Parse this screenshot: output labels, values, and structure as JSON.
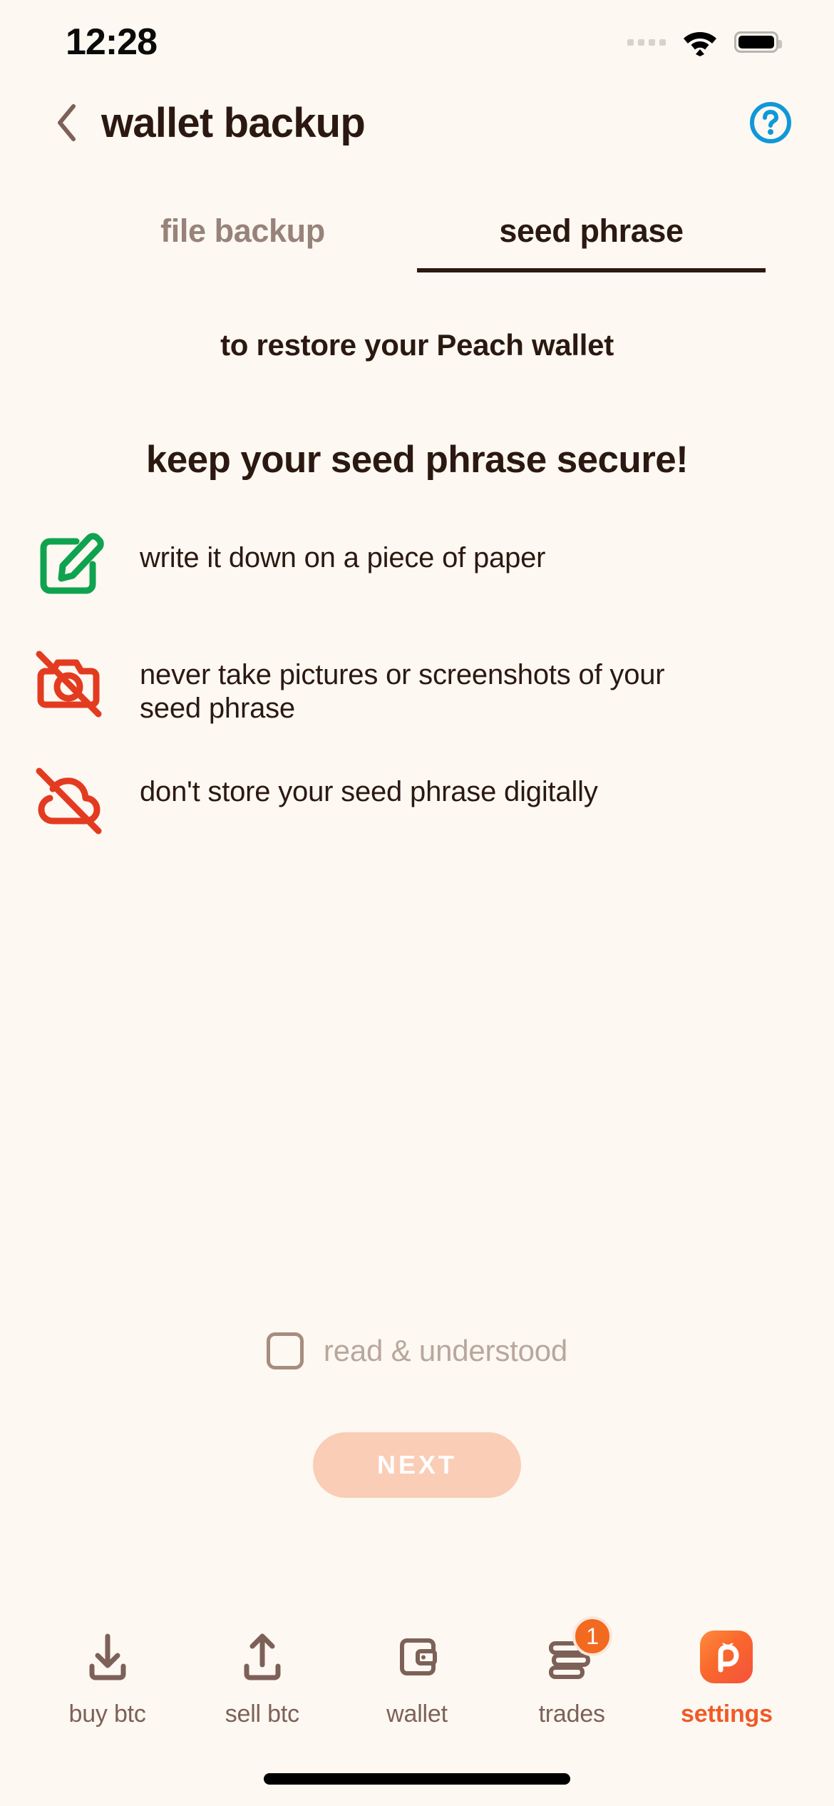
{
  "status_bar": {
    "time": "12:28",
    "signal_icon": "signal-dots-icon",
    "wifi_icon": "wifi-icon",
    "battery_icon": "battery-full-icon"
  },
  "header": {
    "back_icon": "chevron-left-icon",
    "title": "wallet backup",
    "help_icon": "help-circle-icon",
    "help_color": "#1098D8"
  },
  "tabs": [
    {
      "label": "file backup",
      "active": false
    },
    {
      "label": "seed phrase",
      "active": true
    }
  ],
  "main": {
    "subtitle": "to restore your Peach wallet",
    "heading": "keep your seed phrase secure!",
    "bullets": [
      {
        "icon": "edit-square-icon",
        "color": "#0FA34F",
        "text": "write it down on a piece of paper"
      },
      {
        "icon": "camera-off-icon",
        "color": "#E33B20",
        "text": "never take pictures or screenshots of your seed phrase"
      },
      {
        "icon": "cloud-off-icon",
        "color": "#E33B20",
        "text": "don't store your seed phrase digitally"
      }
    ],
    "checkbox": {
      "label": "read & understood",
      "checked": false
    },
    "next_button": {
      "label": "NEXT",
      "enabled": false,
      "color": "#FACDB6"
    }
  },
  "bottom_nav": {
    "items": [
      {
        "label": "buy btc",
        "icon": "download-arrow-icon",
        "active": false,
        "badge": ""
      },
      {
        "label": "sell btc",
        "icon": "upload-arrow-icon",
        "active": false,
        "badge": ""
      },
      {
        "label": "wallet",
        "icon": "wallet-icon",
        "active": false,
        "badge": ""
      },
      {
        "label": "trades",
        "icon": "stacked-bars-icon",
        "active": false,
        "badge": "1"
      },
      {
        "label": "settings",
        "icon": "peach-logo-icon",
        "active": true,
        "badge": ""
      }
    ],
    "active_color": "#F05A28",
    "inactive_color": "#7D6158"
  },
  "home_indicator": "home-indicator-bar"
}
